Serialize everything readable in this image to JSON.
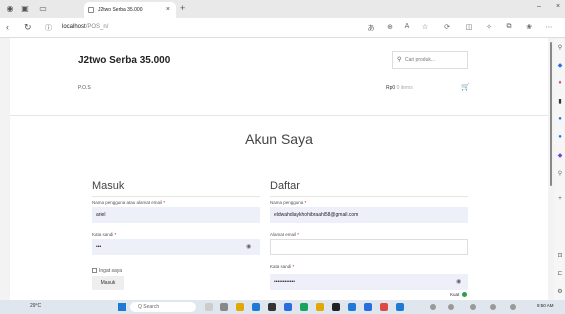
{
  "browser": {
    "tab_title": "J2two Serba 35.000",
    "tab_close": "×",
    "new_tab": "+",
    "url_host": "localhost",
    "url_path": "/POS_n/",
    "icons": [
      "back-icon",
      "reload-icon",
      "info-icon",
      "translate-icon",
      "zoom-icon",
      "read-aloud-icon",
      "favorite-icon",
      "sync-icon",
      "collections-icon",
      "split-screen-icon",
      "extensions-icon",
      "more-icon"
    ]
  },
  "header": {
    "brand": "J2two Serba 35.000",
    "search_placeholder": "Cari produk...",
    "menu_pos": "P.O.S",
    "cart_label": "Rp0",
    "cart_sub": "0 items"
  },
  "page": {
    "title": "Akun Saya"
  },
  "login": {
    "heading": "Masuk",
    "username_label": "Nama pengguna atau alamat email",
    "username_value": "ariel",
    "password_label": "Kata sandi",
    "password_value": "•••",
    "remember_label": "Ingat saya",
    "submit_label": "Masuk"
  },
  "register": {
    "heading": "Daftar",
    "username_label": "Nama pengguna",
    "username_value": "eldwahdiaykhohibraahl58@gmail.com",
    "email_label": "Alamat email",
    "email_value": "",
    "password_label": "Kata sandi",
    "password_value": "••••••••••••",
    "strength_label": "Kuat"
  },
  "required_mark": "*",
  "taskbar": {
    "weather": "29°C",
    "search_placeholder": "Q Search",
    "time": "9:50 AM"
  },
  "colors": {
    "field_bg": "#eef0f9",
    "strength_green": "#2e9e48",
    "start_blue": "#1f7ad6"
  }
}
